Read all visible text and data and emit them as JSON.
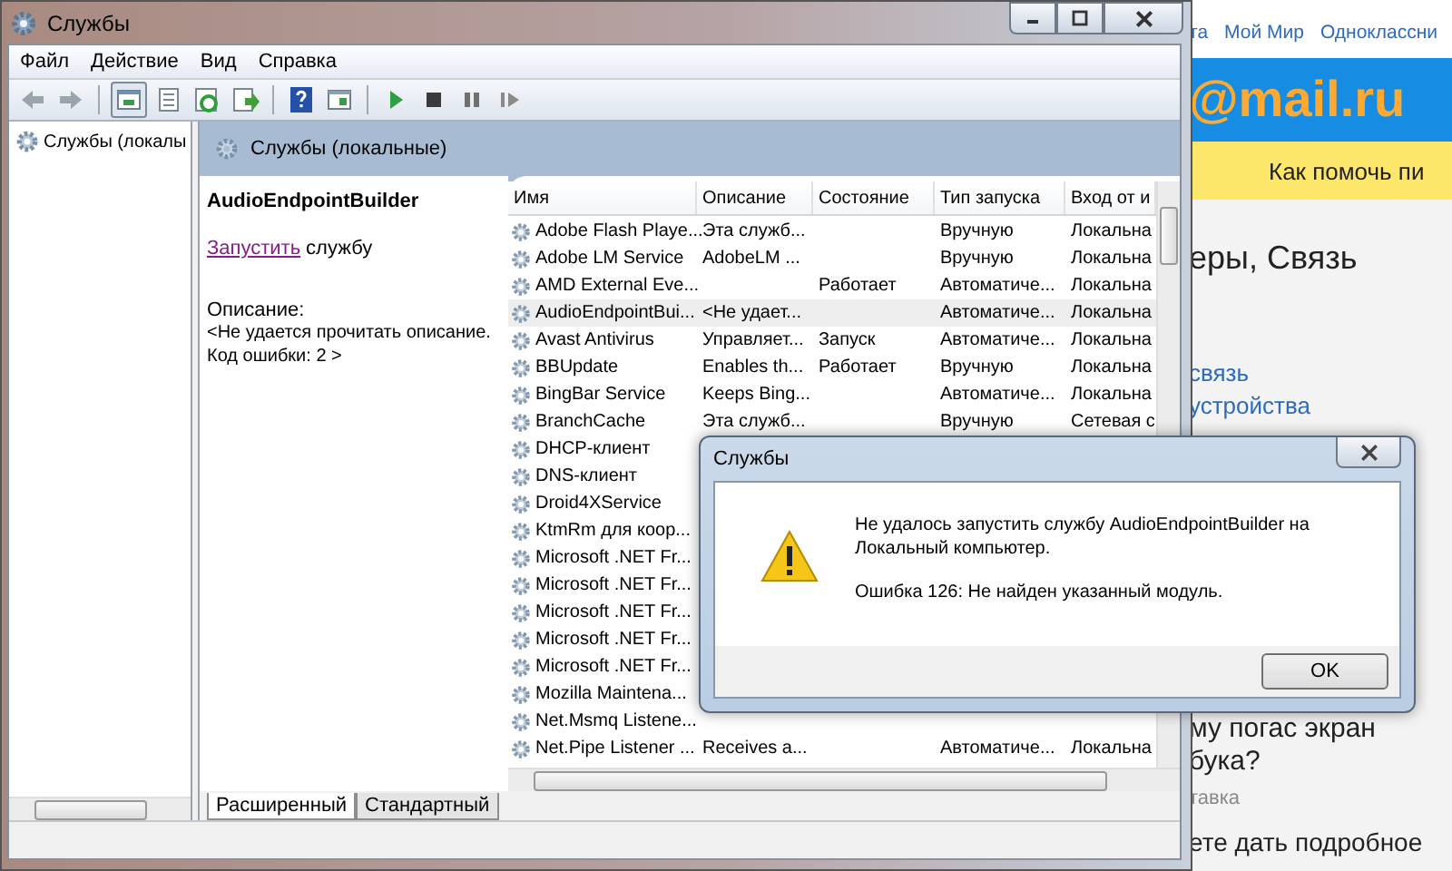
{
  "browser": {
    "top_links": [
      "та",
      "Мой Мир",
      "Одноклассни"
    ],
    "logo": "@mail.ru",
    "banner": "Как помочь пи",
    "heading": "еры, Связь",
    "links": [
      "связь",
      "устройства"
    ],
    "article_lines": [
      "му погас экран",
      "бука?"
    ],
    "meta": "тавка",
    "teaser": "ете дать подробное"
  },
  "window": {
    "title": "Службы"
  },
  "menu": [
    "Файл",
    "Действие",
    "Вид",
    "Справка"
  ],
  "tree": {
    "items": [
      {
        "label": "Службы (локалы"
      }
    ]
  },
  "panel": {
    "title": "Службы (локальные)"
  },
  "details": {
    "service_name": "AudioEndpointBuilder",
    "action_link": "Запустить",
    "action_rest": "службу",
    "description_label": "Описание:",
    "description_lines": [
      "<Не удается прочитать описание.",
      "Код ошибки: 2 >"
    ]
  },
  "table": {
    "columns": [
      "Имя",
      "Описание",
      "Состояние",
      "Тип запуска",
      "Вход от и"
    ],
    "rows": [
      {
        "name": "Adobe Flash Playe...",
        "description": "Эта служб...",
        "startup": "Вручную",
        "logon": "Локальна",
        "selected": false
      },
      {
        "name": "Adobe LM Service",
        "description": "AdobeLM ...",
        "startup": "Вручную",
        "logon": "Локальна",
        "selected": false
      },
      {
        "name": "AMD External Eve...",
        "status": "Работает",
        "startup": "Автоматиче...",
        "logon": "Локальна",
        "selected": false
      },
      {
        "name": "AudioEndpointBui...",
        "description": "<Не удает...",
        "startup": "Автоматиче...",
        "logon": "Локальна",
        "selected": true
      },
      {
        "name": "Avast Antivirus",
        "description": "Управляет...",
        "status": "Запуск",
        "startup": "Автоматиче...",
        "logon": "Локальна",
        "selected": false
      },
      {
        "name": "BBUpdate",
        "description": "Enables th...",
        "status": "Работает",
        "startup": "Вручную",
        "logon": "Локальна",
        "selected": false
      },
      {
        "name": "BingBar Service",
        "description": "Keeps Bing...",
        "startup": "Автоматиче...",
        "logon": "Локальна",
        "selected": false
      },
      {
        "name": "BranchCache",
        "description": "Эта служб...",
        "startup": "Вручную",
        "logon": "Сетевая с",
        "selected": false
      },
      {
        "name": "DHCP-клиент",
        "selected": false
      },
      {
        "name": "DNS-клиент",
        "selected": false
      },
      {
        "name": "Droid4XService",
        "selected": false
      },
      {
        "name": "KtmRm для коор...",
        "selected": false
      },
      {
        "name": "Microsoft .NET Fr...",
        "selected": false
      },
      {
        "name": "Microsoft .NET Fr...",
        "selected": false
      },
      {
        "name": "Microsoft .NET Fr...",
        "selected": false
      },
      {
        "name": "Microsoft .NET Fr...",
        "selected": false
      },
      {
        "name": "Microsoft .NET Fr...",
        "selected": false
      },
      {
        "name": "Mozilla Maintena...",
        "selected": false
      },
      {
        "name": "Net.Msmq Listene...",
        "selected": false
      },
      {
        "name": "Net.Pipe Listener ...",
        "description": "Receives a...",
        "startup": "Автоматиче...",
        "logon": "Локальна",
        "selected": false
      }
    ]
  },
  "view_tabs": [
    {
      "label": "Расширенный",
      "selected": true
    },
    {
      "label": "Стандартный",
      "selected": false
    }
  ],
  "dialog": {
    "title": "Службы",
    "message": "Не удалось запустить службу AudioEndpointBuilder на Локальный компьютер.",
    "error": "Ошибка 126: Не найден указанный модуль.",
    "button": "OK"
  }
}
